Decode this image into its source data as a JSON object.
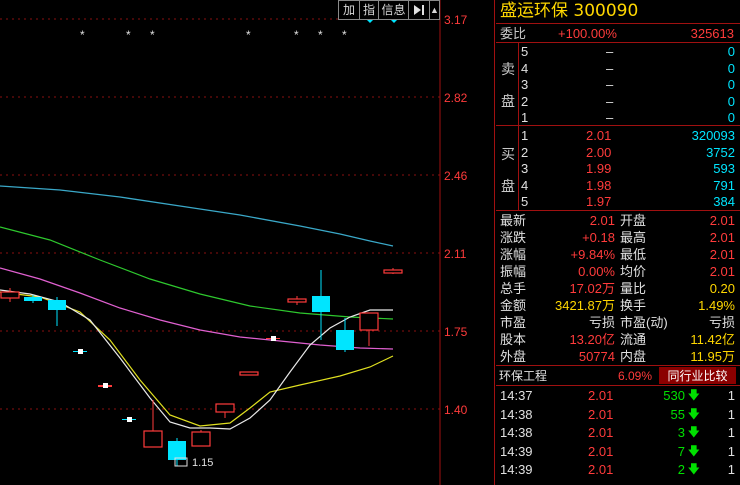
{
  "toolbar": {
    "add_label": "加",
    "index_label": "指",
    "info_label": "信息",
    "expand_icon": "expand-arrow-icon"
  },
  "chart": {
    "price_labels": [
      "3.17",
      "2.82",
      "2.46",
      "2.11",
      "1.75",
      "1.40"
    ],
    "low_label": "1.15",
    "markers": [
      "*",
      "*",
      "*",
      "*",
      "*",
      "*",
      "*"
    ]
  },
  "stock": {
    "name": "盛运环保",
    "code": "300090"
  },
  "weibi": {
    "label": "委比",
    "pct": "+100.00%",
    "diff": "325613"
  },
  "sell": {
    "group_label": [
      "卖",
      "盘"
    ],
    "levels": [
      {
        "n": "5",
        "price": "–",
        "vol": "0"
      },
      {
        "n": "4",
        "price": "–",
        "vol": "0"
      },
      {
        "n": "3",
        "price": "–",
        "vol": "0"
      },
      {
        "n": "2",
        "price": "–",
        "vol": "0"
      },
      {
        "n": "1",
        "price": "–",
        "vol": "0"
      }
    ]
  },
  "buy": {
    "group_label": [
      "买",
      "盘"
    ],
    "levels": [
      {
        "n": "1",
        "price": "2.01",
        "vol": "320093"
      },
      {
        "n": "2",
        "price": "2.00",
        "vol": "3752"
      },
      {
        "n": "3",
        "price": "1.99",
        "vol": "593"
      },
      {
        "n": "4",
        "price": "1.98",
        "vol": "791"
      },
      {
        "n": "5",
        "price": "1.97",
        "vol": "384"
      }
    ]
  },
  "stats": [
    {
      "l1": "最新",
      "v1": "2.01",
      "l2": "开盘",
      "v2": "2.01"
    },
    {
      "l1": "涨跌",
      "v1": "+0.18",
      "l2": "最高",
      "v2": "2.01"
    },
    {
      "l1": "涨幅",
      "v1": "+9.84%",
      "l2": "最低",
      "v2": "2.01"
    },
    {
      "l1": "振幅",
      "v1": "0.00%",
      "l2": "均价",
      "v2": "2.01"
    },
    {
      "l1": "总手",
      "v1": "17.02万",
      "l2": "量比",
      "v2": "0.20"
    },
    {
      "l1": "金额",
      "v1": "3421.87万",
      "l2": "换手",
      "v2": "1.49%"
    },
    {
      "l1": "市盈",
      "v1": "亏损",
      "l2": "市盈(动)",
      "v2": "亏损"
    },
    {
      "l1": "股本",
      "v1": "13.20亿",
      "l2": "流通",
      "v2": "11.42亿"
    },
    {
      "l1": "外盘",
      "v1": "50774",
      "l2": "内盘",
      "v2": "11.95万"
    }
  ],
  "sector": {
    "name": "环保工程",
    "pct": "6.09%",
    "compare_label": "同行业比较"
  },
  "ticks": [
    {
      "time": "14:37",
      "price": "2.01",
      "vol": "530",
      "n": "1"
    },
    {
      "time": "14:38",
      "price": "2.01",
      "vol": "55",
      "n": "1"
    },
    {
      "time": "14:38",
      "price": "2.01",
      "vol": "3",
      "n": "1"
    },
    {
      "time": "14:39",
      "price": "2.01",
      "vol": "7",
      "n": "1"
    },
    {
      "time": "14:39",
      "price": "2.01",
      "vol": "2",
      "n": "1"
    }
  ],
  "colors": {
    "up": "#ff3b3b",
    "down": "#00e5ff",
    "title": "#ffd700",
    "grid": "#a01010"
  }
}
